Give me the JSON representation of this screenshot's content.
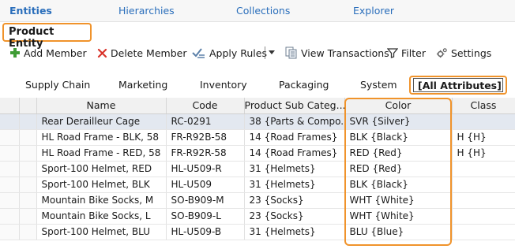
{
  "topnav": {
    "tabs": [
      {
        "label": "Entities",
        "active": true
      },
      {
        "label": "Hierarchies",
        "active": false
      },
      {
        "label": "Collections",
        "active": false
      },
      {
        "label": "Explorer",
        "active": false
      }
    ]
  },
  "entity": {
    "title": "Product Entity"
  },
  "toolbar": {
    "add_member": "Add Member",
    "delete_member": "Delete Member",
    "apply_rules": "Apply Rules",
    "view_transactions": "View Transactions",
    "filter": "Filter",
    "settings": "Settings"
  },
  "subtabs": [
    {
      "label": "Supply Chain"
    },
    {
      "label": "Marketing"
    },
    {
      "label": "Inventory"
    },
    {
      "label": "Packaging"
    },
    {
      "label": "System"
    },
    {
      "label": "[All Attributes]",
      "active": true
    }
  ],
  "grid": {
    "columns": [
      "Name",
      "Code",
      "Product Sub Categ...",
      "Color",
      "Class"
    ],
    "rows": [
      {
        "name": "Rear Derailleur Cage",
        "code": "RC-0291",
        "subcat": "38 {Parts & Compo...",
        "color": "SVR {Silver}",
        "class": ""
      },
      {
        "name": "HL Road Frame - BLK, 58",
        "code": "FR-R92B-58",
        "subcat": "14 {Road Frames}",
        "color": "BLK {Black}",
        "class": "H {H}"
      },
      {
        "name": "HL Road Frame - RED, 58",
        "code": "FR-R92R-58",
        "subcat": "14 {Road Frames}",
        "color": "RED {Red}",
        "class": "H {H}"
      },
      {
        "name": "Sport-100 Helmet, RED",
        "code": "HL-U509-R",
        "subcat": "31 {Helmets}",
        "color": "RED {Red}",
        "class": ""
      },
      {
        "name": "Sport-100 Helmet, BLK",
        "code": "HL-U509",
        "subcat": "31 {Helmets}",
        "color": "BLK {Black}",
        "class": ""
      },
      {
        "name": "Mountain Bike Socks, M",
        "code": "SO-B909-M",
        "subcat": "23 {Socks}",
        "color": "WHT {White}",
        "class": ""
      },
      {
        "name": "Mountain Bike Socks, L",
        "code": "SO-B909-L",
        "subcat": "23 {Socks}",
        "color": "WHT {White}",
        "class": ""
      },
      {
        "name": "Sport-100 Helmet, BLU",
        "code": "HL-U509-B",
        "subcat": "31 {Helmets}",
        "color": "BLU {Blue}",
        "class": ""
      }
    ]
  },
  "colors": {
    "accent_orange": "#f0932b",
    "link_blue": "#2a6ebb",
    "selected_row": "#e3e8f0"
  }
}
